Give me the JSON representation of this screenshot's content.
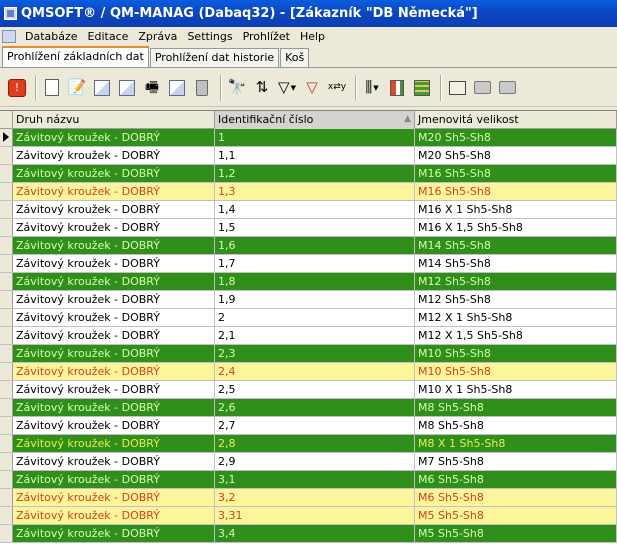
{
  "window": {
    "title": "QMSOFT® / QM-MANAG (Dabaq32) - [Zákazník \"DB Německá\"]"
  },
  "menu": [
    "Databáze",
    "Editace",
    "Zpráva",
    "Settings",
    "Prohlížet",
    "Help"
  ],
  "tabs": [
    "Prohlížení základních dat",
    "Prohlížení dat historie",
    "Koš"
  ],
  "toolbar_icons": [
    "stop-icon",
    "new-document-icon",
    "edit-document-icon",
    "copy-records-icon",
    "move-records-icon",
    "printer-records-icon",
    "duplicate-icon",
    "delete-icon",
    "binoculars-icon",
    "sort-icon",
    "filter-icon",
    "filter-remove-icon",
    "swap-xy-icon",
    "columns-icon",
    "grid-colors-icon",
    "grid-view-icon",
    "card-view-icon",
    "print-preview-icon",
    "print-icon"
  ],
  "grid": {
    "columns": [
      "Druh názvu",
      "Identifikační číslo",
      "Jmenovitá velikost"
    ],
    "rows": [
      {
        "style": "green",
        "name": "Závitový kroužek - DOBRÝ",
        "id": "1",
        "size": "M20 Sh5-Sh8"
      },
      {
        "style": "white",
        "name": "Závitový kroužek - DOBRÝ",
        "id": "1,1",
        "size": "M20 Sh5-Sh8"
      },
      {
        "style": "green",
        "name": "Závitový kroužek - DOBRÝ",
        "id": "1,2",
        "size": "M16 Sh5-Sh8"
      },
      {
        "style": "yellow",
        "name": "Závitový kroužek - DOBRÝ",
        "id": "1,3",
        "size": "M16 Sh5-Sh8"
      },
      {
        "style": "white",
        "name": "Závitový kroužek - DOBRÝ",
        "id": "1,4",
        "size": "M16 X 1 Sh5-Sh8"
      },
      {
        "style": "white",
        "name": "Závitový kroužek - DOBRÝ",
        "id": "1,5",
        "size": "M16 X 1,5 Sh5-Sh8"
      },
      {
        "style": "green",
        "name": "Závitový kroužek - DOBRÝ",
        "id": "1,6",
        "size": "M14 Sh5-Sh8"
      },
      {
        "style": "white",
        "name": "Závitový kroužek - DOBRÝ",
        "id": "1,7",
        "size": "M14 Sh5-Sh8"
      },
      {
        "style": "green",
        "name": "Závitový kroužek - DOBRÝ",
        "id": "1,8",
        "size": "M12 Sh5-Sh8"
      },
      {
        "style": "white",
        "name": "Závitový kroužek - DOBRÝ",
        "id": "1,9",
        "size": "M12 Sh5-Sh8"
      },
      {
        "style": "white",
        "name": "Závitový kroužek - DOBRÝ",
        "id": "2",
        "size": "M12 X 1 Sh5-Sh8"
      },
      {
        "style": "white",
        "name": "Závitový kroužek - DOBRÝ",
        "id": "2,1",
        "size": "M12 X 1,5 Sh5-Sh8"
      },
      {
        "style": "green",
        "name": "Závitový kroužek - DOBRÝ",
        "id": "2,3",
        "size": "M10 Sh5-Sh8"
      },
      {
        "style": "yellow",
        "name": "Závitový kroužek - DOBRÝ",
        "id": "2,4",
        "size": "M10 Sh5-Sh8"
      },
      {
        "style": "white",
        "name": "Závitový kroužek - DOBRÝ",
        "id": "2,5",
        "size": "M10 X 1 Sh5-Sh8"
      },
      {
        "style": "green",
        "name": "Závitový kroužek - DOBRÝ",
        "id": "2,6",
        "size": "M8 Sh5-Sh8"
      },
      {
        "style": "white",
        "name": "Závitový kroužek - DOBRÝ",
        "id": "2,7",
        "size": "M8 Sh5-Sh8"
      },
      {
        "style": "green-hl",
        "name": "Závitový kroužek - DOBRÝ",
        "id": "2,8",
        "size": "M8 X 1 Sh5-Sh8"
      },
      {
        "style": "white",
        "name": "Závitový kroužek - DOBRÝ",
        "id": "2,9",
        "size": "M7 Sh5-Sh8"
      },
      {
        "style": "green",
        "name": "Závitový kroužek - DOBRÝ",
        "id": "3,1",
        "size": "M6 Sh5-Sh8"
      },
      {
        "style": "yellow",
        "name": "Závitový kroužek - DOBRÝ",
        "id": "3,2",
        "size": "M6 Sh5-Sh8"
      },
      {
        "style": "yellow",
        "name": "Závitový kroužek - DOBRÝ",
        "id": "3,31",
        "size": "M5 Sh5-Sh8"
      },
      {
        "style": "green",
        "name": "Závitový kroužek - DOBRÝ",
        "id": "3,4",
        "size": "M5 Sh5-Sh8"
      }
    ]
  },
  "colors": {
    "row_green": "#2f8f1a",
    "row_yellow": "#fdf59c",
    "titlebar": "#0a47c4"
  }
}
